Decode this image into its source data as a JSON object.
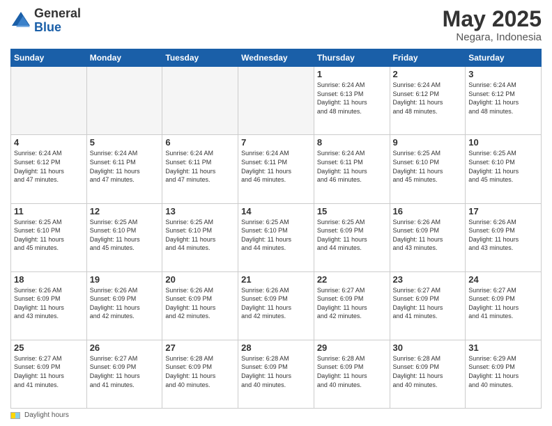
{
  "logo": {
    "general": "General",
    "blue": "Blue"
  },
  "title": "May 2025",
  "subtitle": "Negara, Indonesia",
  "days_header": [
    "Sunday",
    "Monday",
    "Tuesday",
    "Wednesday",
    "Thursday",
    "Friday",
    "Saturday"
  ],
  "footer": {
    "icon_label": "Daylight hours"
  },
  "weeks": [
    [
      {
        "num": "",
        "info": ""
      },
      {
        "num": "",
        "info": ""
      },
      {
        "num": "",
        "info": ""
      },
      {
        "num": "",
        "info": ""
      },
      {
        "num": "1",
        "info": "Sunrise: 6:24 AM\nSunset: 6:13 PM\nDaylight: 11 hours\nand 48 minutes."
      },
      {
        "num": "2",
        "info": "Sunrise: 6:24 AM\nSunset: 6:12 PM\nDaylight: 11 hours\nand 48 minutes."
      },
      {
        "num": "3",
        "info": "Sunrise: 6:24 AM\nSunset: 6:12 PM\nDaylight: 11 hours\nand 48 minutes."
      }
    ],
    [
      {
        "num": "4",
        "info": "Sunrise: 6:24 AM\nSunset: 6:12 PM\nDaylight: 11 hours\nand 47 minutes."
      },
      {
        "num": "5",
        "info": "Sunrise: 6:24 AM\nSunset: 6:11 PM\nDaylight: 11 hours\nand 47 minutes."
      },
      {
        "num": "6",
        "info": "Sunrise: 6:24 AM\nSunset: 6:11 PM\nDaylight: 11 hours\nand 47 minutes."
      },
      {
        "num": "7",
        "info": "Sunrise: 6:24 AM\nSunset: 6:11 PM\nDaylight: 11 hours\nand 46 minutes."
      },
      {
        "num": "8",
        "info": "Sunrise: 6:24 AM\nSunset: 6:11 PM\nDaylight: 11 hours\nand 46 minutes."
      },
      {
        "num": "9",
        "info": "Sunrise: 6:25 AM\nSunset: 6:10 PM\nDaylight: 11 hours\nand 45 minutes."
      },
      {
        "num": "10",
        "info": "Sunrise: 6:25 AM\nSunset: 6:10 PM\nDaylight: 11 hours\nand 45 minutes."
      }
    ],
    [
      {
        "num": "11",
        "info": "Sunrise: 6:25 AM\nSunset: 6:10 PM\nDaylight: 11 hours\nand 45 minutes."
      },
      {
        "num": "12",
        "info": "Sunrise: 6:25 AM\nSunset: 6:10 PM\nDaylight: 11 hours\nand 45 minutes."
      },
      {
        "num": "13",
        "info": "Sunrise: 6:25 AM\nSunset: 6:10 PM\nDaylight: 11 hours\nand 44 minutes."
      },
      {
        "num": "14",
        "info": "Sunrise: 6:25 AM\nSunset: 6:10 PM\nDaylight: 11 hours\nand 44 minutes."
      },
      {
        "num": "15",
        "info": "Sunrise: 6:25 AM\nSunset: 6:09 PM\nDaylight: 11 hours\nand 44 minutes."
      },
      {
        "num": "16",
        "info": "Sunrise: 6:26 AM\nSunset: 6:09 PM\nDaylight: 11 hours\nand 43 minutes."
      },
      {
        "num": "17",
        "info": "Sunrise: 6:26 AM\nSunset: 6:09 PM\nDaylight: 11 hours\nand 43 minutes."
      }
    ],
    [
      {
        "num": "18",
        "info": "Sunrise: 6:26 AM\nSunset: 6:09 PM\nDaylight: 11 hours\nand 43 minutes."
      },
      {
        "num": "19",
        "info": "Sunrise: 6:26 AM\nSunset: 6:09 PM\nDaylight: 11 hours\nand 42 minutes."
      },
      {
        "num": "20",
        "info": "Sunrise: 6:26 AM\nSunset: 6:09 PM\nDaylight: 11 hours\nand 42 minutes."
      },
      {
        "num": "21",
        "info": "Sunrise: 6:26 AM\nSunset: 6:09 PM\nDaylight: 11 hours\nand 42 minutes."
      },
      {
        "num": "22",
        "info": "Sunrise: 6:27 AM\nSunset: 6:09 PM\nDaylight: 11 hours\nand 42 minutes."
      },
      {
        "num": "23",
        "info": "Sunrise: 6:27 AM\nSunset: 6:09 PM\nDaylight: 11 hours\nand 41 minutes."
      },
      {
        "num": "24",
        "info": "Sunrise: 6:27 AM\nSunset: 6:09 PM\nDaylight: 11 hours\nand 41 minutes."
      }
    ],
    [
      {
        "num": "25",
        "info": "Sunrise: 6:27 AM\nSunset: 6:09 PM\nDaylight: 11 hours\nand 41 minutes."
      },
      {
        "num": "26",
        "info": "Sunrise: 6:27 AM\nSunset: 6:09 PM\nDaylight: 11 hours\nand 41 minutes."
      },
      {
        "num": "27",
        "info": "Sunrise: 6:28 AM\nSunset: 6:09 PM\nDaylight: 11 hours\nand 40 minutes."
      },
      {
        "num": "28",
        "info": "Sunrise: 6:28 AM\nSunset: 6:09 PM\nDaylight: 11 hours\nand 40 minutes."
      },
      {
        "num": "29",
        "info": "Sunrise: 6:28 AM\nSunset: 6:09 PM\nDaylight: 11 hours\nand 40 minutes."
      },
      {
        "num": "30",
        "info": "Sunrise: 6:28 AM\nSunset: 6:09 PM\nDaylight: 11 hours\nand 40 minutes."
      },
      {
        "num": "31",
        "info": "Sunrise: 6:29 AM\nSunset: 6:09 PM\nDaylight: 11 hours\nand 40 minutes."
      }
    ]
  ]
}
